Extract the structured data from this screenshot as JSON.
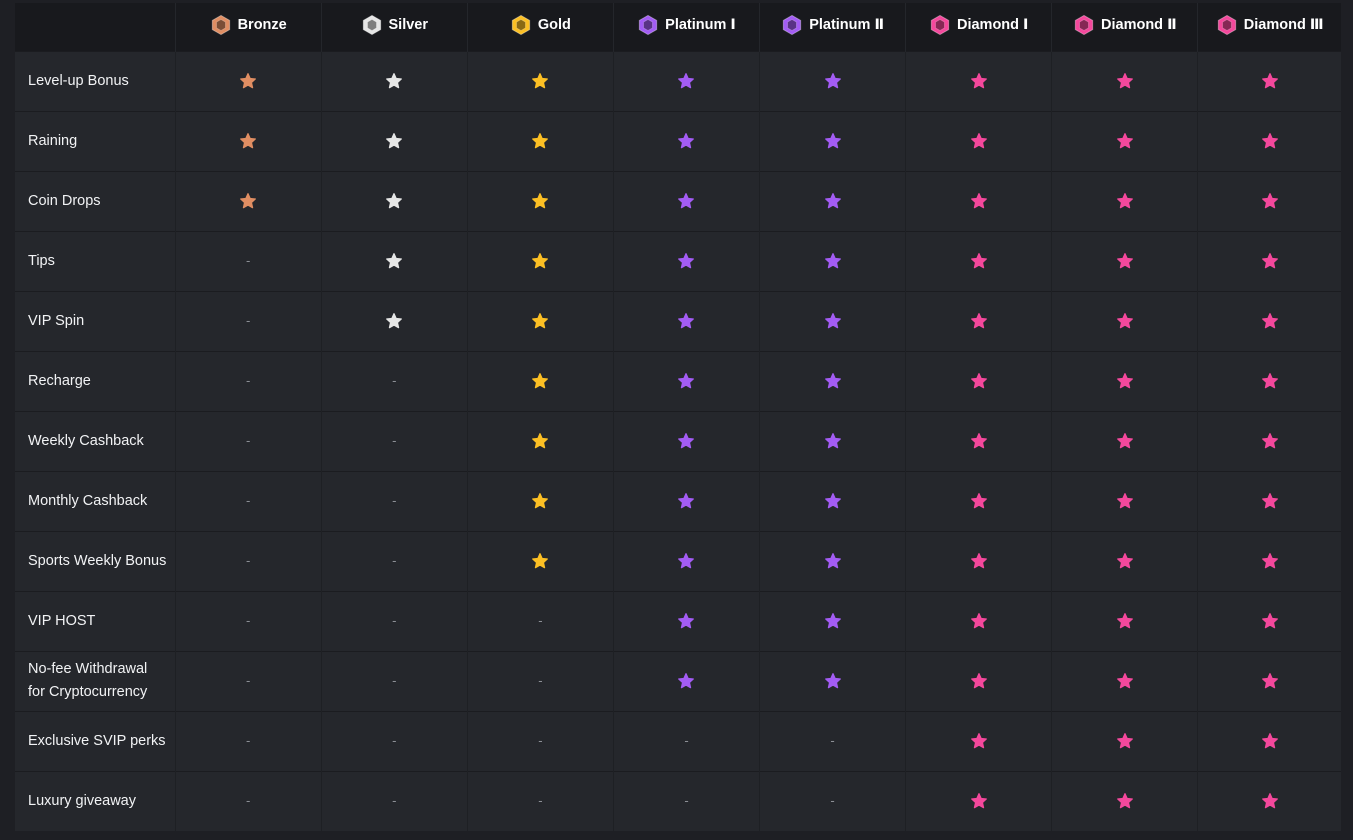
{
  "colors": {
    "bronze": "#e08e63",
    "silver": "#e6e6e6",
    "gold": "#fbbf24",
    "platinum": "#a35cf4",
    "diamond": "#f4489c",
    "dash": "#8c8f96",
    "row_bg": "#25272c",
    "header_bg": "#18191d"
  },
  "tiers": [
    {
      "name": "Bronze",
      "color_key": "bronze",
      "icon": "hexagon-badge-icon"
    },
    {
      "name": "Silver",
      "color_key": "silver",
      "icon": "hexagon-badge-icon"
    },
    {
      "name": "Gold",
      "color_key": "gold",
      "icon": "hexagon-badge-icon"
    },
    {
      "name": "Platinum Ⅰ",
      "color_key": "platinum",
      "icon": "hexagon-badge-icon"
    },
    {
      "name": "Platinum Ⅱ",
      "color_key": "platinum",
      "icon": "hexagon-badge-icon"
    },
    {
      "name": "Diamond Ⅰ",
      "color_key": "diamond",
      "icon": "hexagon-badge-icon"
    },
    {
      "name": "Diamond Ⅱ",
      "color_key": "diamond",
      "icon": "hexagon-badge-icon"
    },
    {
      "name": "Diamond Ⅲ",
      "color_key": "diamond",
      "icon": "hexagon-badge-icon"
    }
  ],
  "unavailable_mark": "-",
  "features": [
    {
      "label": "Level-up Bonus",
      "available": [
        true,
        true,
        true,
        true,
        true,
        true,
        true,
        true
      ]
    },
    {
      "label": "Raining",
      "available": [
        true,
        true,
        true,
        true,
        true,
        true,
        true,
        true
      ]
    },
    {
      "label": "Coin Drops",
      "available": [
        true,
        true,
        true,
        true,
        true,
        true,
        true,
        true
      ]
    },
    {
      "label": "Tips",
      "available": [
        false,
        true,
        true,
        true,
        true,
        true,
        true,
        true
      ]
    },
    {
      "label": "VIP Spin",
      "available": [
        false,
        true,
        true,
        true,
        true,
        true,
        true,
        true
      ]
    },
    {
      "label": "Recharge",
      "available": [
        false,
        false,
        true,
        true,
        true,
        true,
        true,
        true
      ]
    },
    {
      "label": "Weekly Cashback",
      "available": [
        false,
        false,
        true,
        true,
        true,
        true,
        true,
        true
      ]
    },
    {
      "label": "Monthly Cashback",
      "available": [
        false,
        false,
        true,
        true,
        true,
        true,
        true,
        true
      ]
    },
    {
      "label": "Sports Weekly Bonus",
      "available": [
        false,
        false,
        true,
        true,
        true,
        true,
        true,
        true
      ]
    },
    {
      "label": "VIP HOST",
      "available": [
        false,
        false,
        false,
        true,
        true,
        true,
        true,
        true
      ]
    },
    {
      "label": "No-fee Withdrawal for Cryptocurrency",
      "available": [
        false,
        false,
        false,
        true,
        true,
        true,
        true,
        true
      ]
    },
    {
      "label": "Exclusive SVIP perks",
      "available": [
        false,
        false,
        false,
        false,
        false,
        true,
        true,
        true
      ]
    },
    {
      "label": "Luxury giveaway",
      "available": [
        false,
        false,
        false,
        false,
        false,
        true,
        true,
        true
      ]
    }
  ]
}
